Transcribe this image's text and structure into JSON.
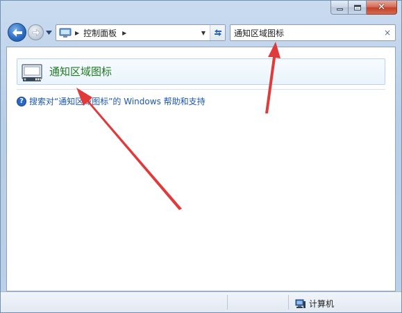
{
  "window": {
    "caption_buttons": [
      {
        "name": "minimize",
        "icon": "minimize-icon"
      },
      {
        "name": "maximize",
        "icon": "maximize-icon"
      },
      {
        "name": "close",
        "icon": "close-icon"
      }
    ]
  },
  "nav": {
    "back_icon": "back-arrow-icon",
    "forward_icon": "forward-arrow-icon",
    "recent_icon": "chevron-down-icon"
  },
  "address": {
    "path_label": "控制面板",
    "refresh_icon": "refresh-icon"
  },
  "search": {
    "value": "通知区域图标",
    "clear_symbol": "×"
  },
  "results": {
    "items": [
      {
        "title": "通知区域图标",
        "icon": "notification-area-icon"
      }
    ],
    "help_link": "搜索对“通知区域图标”的 Windows 帮助和支持"
  },
  "status_bar": {
    "computer_label": "计算机"
  },
  "colors": {
    "accent_green": "#1f7a1f",
    "link_blue": "#1c56b3",
    "annotation_red": "#e03a3a"
  }
}
